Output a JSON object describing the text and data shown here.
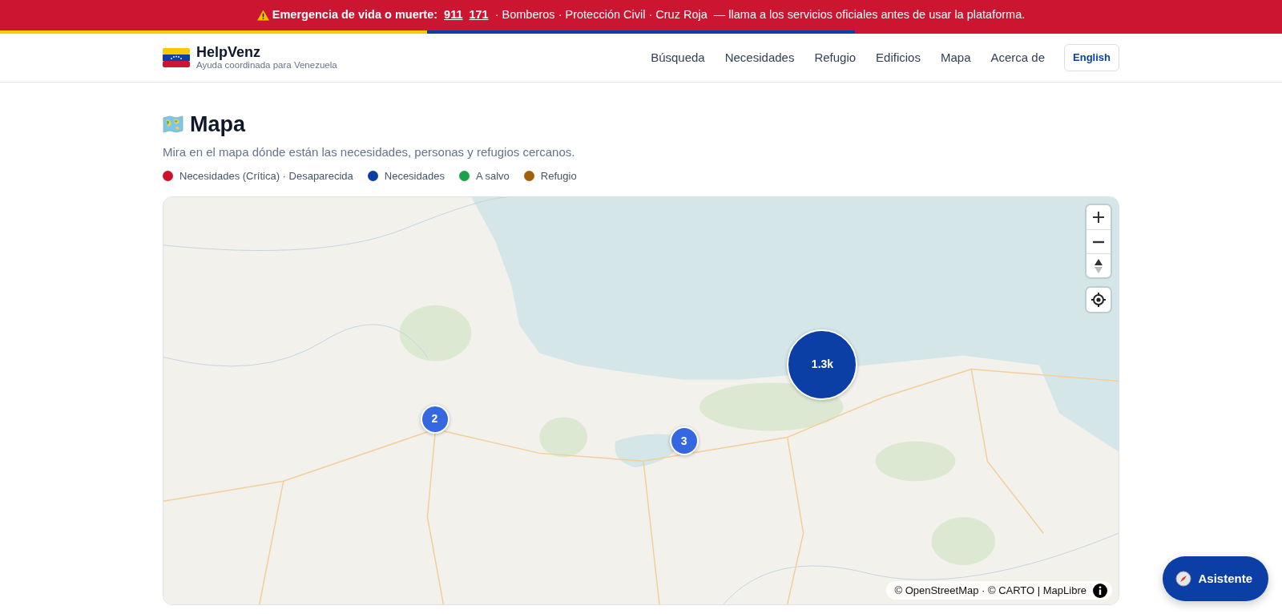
{
  "alert_banner": {
    "label": "Emergencia de vida o muerte:",
    "numbers": [
      "911",
      "171"
    ],
    "services": "· Bomberos · Protección Civil · Cruz Roja",
    "note": "— llama a los servicios oficiales antes de usar la plataforma."
  },
  "brand": {
    "name": "HelpVenz",
    "tagline": "Ayuda coordinada para Venezuela"
  },
  "nav": [
    {
      "label": "Búsqueda"
    },
    {
      "label": "Necesidades"
    },
    {
      "label": "Refugio"
    },
    {
      "label": "Edificios"
    },
    {
      "label": "Mapa"
    },
    {
      "label": "Acerca de"
    }
  ],
  "language_button": "English",
  "page": {
    "title": "Mapa",
    "subtitle": "Mira en el mapa dónde están las necesidades, personas y refugios cercanos."
  },
  "legend": [
    {
      "label": "Necesidades (Crítica) · Desaparecida",
      "color": "#d0112b"
    },
    {
      "label": "Necesidades",
      "color": "#0b3fa6"
    },
    {
      "label": "A salvo",
      "color": "#16a34a"
    },
    {
      "label": "Refugio",
      "color": "#a0600e"
    }
  ],
  "map": {
    "clusters": [
      {
        "count": "2",
        "kind": "small"
      },
      {
        "count": "3",
        "kind": "small"
      },
      {
        "count": "1.3k",
        "kind": "large"
      }
    ],
    "attribution": "© OpenStreetMap · © CARTO | MapLibre"
  },
  "assistant_button": "Asistente"
}
